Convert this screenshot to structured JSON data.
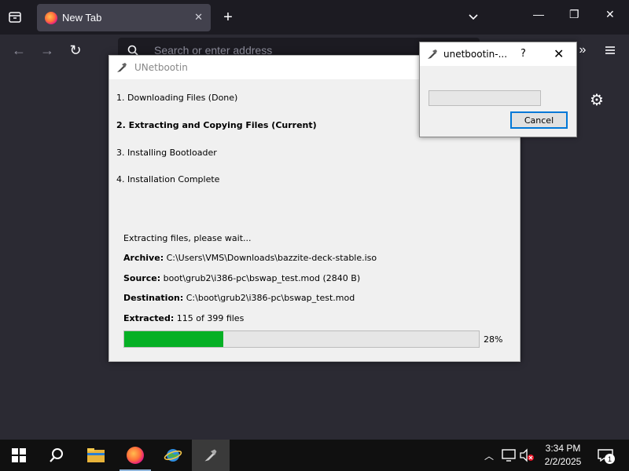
{
  "browser": {
    "tab_title": "New Tab",
    "url_placeholder": "Search or enter address"
  },
  "unetbootin": {
    "window_title": "UNetbootin",
    "steps": [
      {
        "label": "1. Downloading Files (Done)",
        "bold": false
      },
      {
        "label": "2. Extracting and Copying Files (Current)",
        "bold": true
      },
      {
        "label": "3. Installing Bootloader",
        "bold": false
      },
      {
        "label": "4. Installation Complete",
        "bold": false
      }
    ],
    "status_text": "Extracting files, please wait...",
    "archive_label": "Archive:",
    "archive_value": "C:\\Users\\VMS\\Downloads\\bazzite-deck-stable.iso",
    "source_label": "Source:",
    "source_value": "boot\\grub2\\i386-pc\\bswap_test.mod (2840 B)",
    "destination_label": "Destination:",
    "destination_value": "C:\\boot\\grub2\\i386-pc\\bswap_test.mod",
    "extracted_label": "Extracted:",
    "extracted_value": "115 of 399 files",
    "progress_percent": 28,
    "progress_label": "28%",
    "progress_color": "#06b025"
  },
  "dialog": {
    "title": "unetbootin-...",
    "help": "?",
    "cancel_label": "Cancel"
  },
  "taskbar": {
    "time": "3:34 PM",
    "date": "2/2/2025",
    "notification_count": "1",
    "apps": [
      "start-icon",
      "search-icon",
      "file-explorer-icon",
      "firefox-icon",
      "network-globe-icon",
      "unetbootin-icon"
    ]
  }
}
